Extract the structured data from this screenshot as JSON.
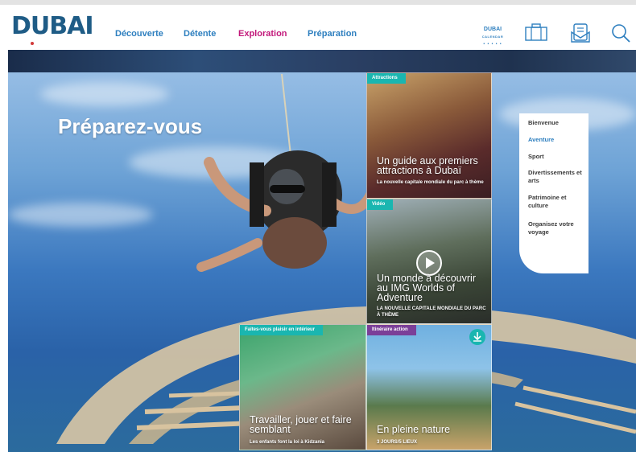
{
  "header": {
    "logo_text": "DUBAI",
    "nav": [
      {
        "label": "Découverte"
      },
      {
        "label": "Détente"
      },
      {
        "label": "Exploration"
      },
      {
        "label": "Préparation"
      }
    ],
    "calendar_label": "DUBAI",
    "calendar_sub": "CALENDAR",
    "icons": [
      "calendar-icon",
      "suitcase-icon",
      "brochure-icon",
      "search-icon"
    ],
    "colors": {
      "nav": "#2e7fbf",
      "nav_active": "#c2187a",
      "logo": "#1f5c86"
    }
  },
  "hero": {
    "title": "Préparez-vous"
  },
  "cards": [
    {
      "tag": "Attractions",
      "title": "Un guide aux premiers attractions à Dubaï",
      "subtitle": "La nouvelle capitale mondiale du parc à thème",
      "tag_color": "#1ab6b0"
    },
    {
      "tag": "Vidéo",
      "title": "Un monde à découvrir au IMG Worlds of Adventure",
      "subtitle": "LA NOUVELLE CAPITALE MONDIALE DU PARC À THÈME",
      "tag_color": "#1ab6b0",
      "icon": "play-icon"
    },
    {
      "tag": "Faites-vous plaisir en intérieur",
      "title": "Travailler, jouer et faire semblant",
      "subtitle": "Les enfants font la loi à Kidzania",
      "tag_color": "#1ab6b0"
    },
    {
      "tag": "Itinéraire action",
      "title": "En pleine nature",
      "subtitle": "3 JOURS/5 LIEUX",
      "tag_color": "#7b3f98",
      "icon": "download-icon"
    }
  ],
  "sidemenu": {
    "items": [
      {
        "label": "Bienvenue"
      },
      {
        "label": "Aventure"
      },
      {
        "label": "Sport"
      },
      {
        "label": "Divertissements et arts"
      },
      {
        "label": "Patrimoine et culture"
      },
      {
        "label": "Organisez votre voyage"
      }
    ],
    "active_color": "#2e7fbf"
  }
}
